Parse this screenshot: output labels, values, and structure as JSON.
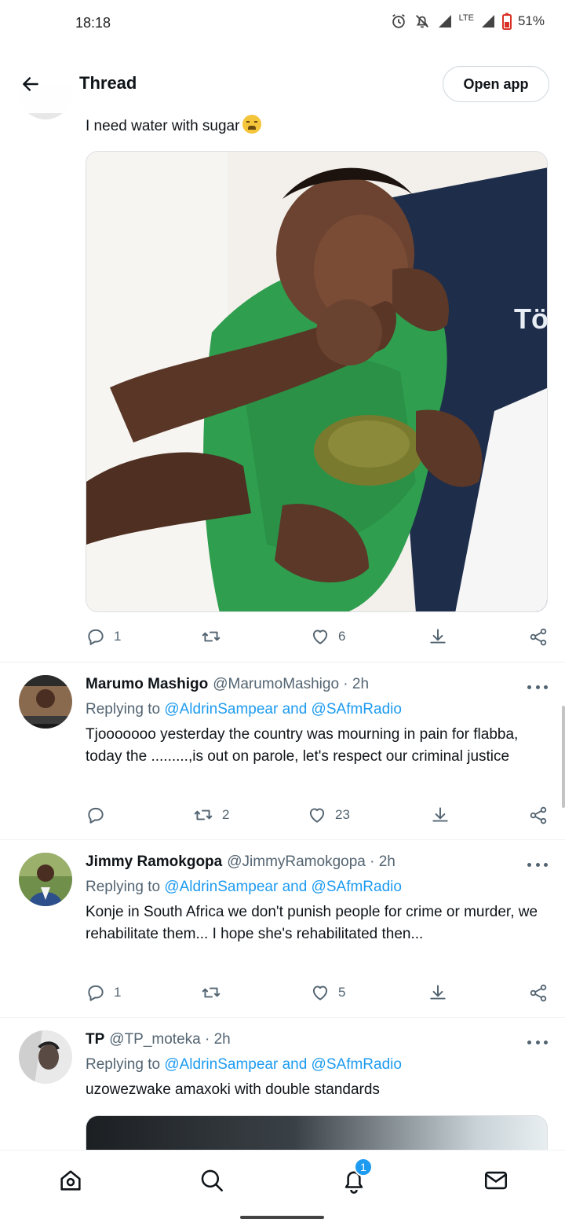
{
  "status_bar": {
    "time": "18:18",
    "network": "LTE",
    "battery": "51%"
  },
  "header": {
    "title": "Thread",
    "open_app": "Open app"
  },
  "main_tweet": {
    "text": "I need water with sugar",
    "emoji": "weary-face",
    "actions": {
      "replies": "1",
      "retweets": "",
      "likes": "6"
    }
  },
  "replies": [
    {
      "name": "Marumo Mashigo",
      "handle": "@MarumoMashigo · 2h",
      "replying_prefix": "Replying to ",
      "replying_to": "@AldrinSampear and @SAfmRadio",
      "text": "Tjooooooo yesterday the country was mourning in pain for flabba, today the .........,is out on parole, let's respect our criminal justice",
      "actions": {
        "replies": "",
        "retweets": "2",
        "likes": "23"
      }
    },
    {
      "name": "Jimmy Ramokgopa",
      "handle": "@JimmyRamokgopa · 2h",
      "replying_prefix": "Replying to ",
      "replying_to": "@AldrinSampear and @SAfmRadio",
      "text": "Konje in South Africa we don't punish people for crime or murder, we rehabilitate them... I hope she's rehabilitated then...",
      "actions": {
        "replies": "1",
        "retweets": "",
        "likes": "5"
      }
    },
    {
      "name": "TP",
      "handle": "@TP_moteka · 2h",
      "replying_prefix": "Replying to ",
      "replying_to": "@AldrinSampear and @SAfmRadio",
      "text": "uzowezwake amaxoki with double standards"
    }
  ],
  "bottom_nav": {
    "notifications_badge": "1"
  },
  "colors": {
    "accent": "#1d9bf0",
    "text": "#0f1419",
    "secondary": "#536471"
  }
}
